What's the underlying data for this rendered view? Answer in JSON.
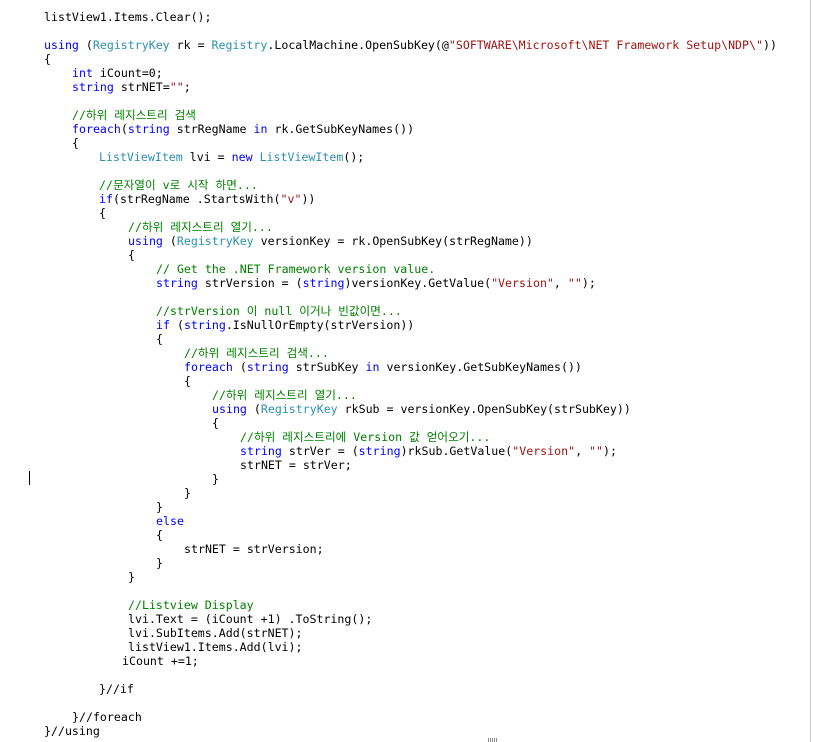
{
  "code": {
    "lines": [
      [
        {
          "t": "listView1.Items.Clear();"
        }
      ],
      [
        {
          "t": "using",
          "c": "kw"
        },
        {
          "t": " ("
        },
        {
          "t": "RegistryKey",
          "c": "typ"
        },
        {
          "t": " rk = "
        },
        {
          "t": "Registry",
          "c": "typ"
        },
        {
          "t": ".LocalMachine.OpenSubKey(@"
        },
        {
          "t": "\"SOFTWARE\\Microsoft\\NET Framework Setup\\NDP\\\"",
          "c": "str"
        },
        {
          "t": "))"
        }
      ],
      [
        {
          "t": "{"
        }
      ],
      [
        {
          "t": "int",
          "c": "kw"
        },
        {
          "t": " iCount=0;"
        }
      ],
      [
        {
          "t": "string",
          "c": "kw"
        },
        {
          "t": " strNET="
        },
        {
          "t": "\"\"",
          "c": "str"
        },
        {
          "t": ";"
        }
      ],
      [
        {
          "t": "//하위 레지스트리 검색",
          "c": "cm"
        }
      ],
      [
        {
          "t": "foreach",
          "c": "kw"
        },
        {
          "t": "("
        },
        {
          "t": "string",
          "c": "kw"
        },
        {
          "t": " strRegName "
        },
        {
          "t": "in",
          "c": "kw"
        },
        {
          "t": " rk.GetSubKeyNames())"
        }
      ],
      [
        {
          "t": "{"
        }
      ],
      [
        {
          "t": "ListViewItem",
          "c": "typ"
        },
        {
          "t": " lvi = "
        },
        {
          "t": "new",
          "c": "kw"
        },
        {
          "t": " "
        },
        {
          "t": "ListViewItem",
          "c": "typ"
        },
        {
          "t": "();"
        }
      ],
      [
        {
          "t": "//문자열이 v로 시작 하면...",
          "c": "cm"
        }
      ],
      [
        {
          "t": "if",
          "c": "kw"
        },
        {
          "t": "(strRegName .StartsWith("
        },
        {
          "t": "\"v\"",
          "c": "str"
        },
        {
          "t": "))"
        }
      ],
      [
        {
          "t": "{"
        }
      ],
      [
        {
          "t": "//하위 레지스트리 열기...",
          "c": "cm"
        }
      ],
      [
        {
          "t": "using",
          "c": "kw"
        },
        {
          "t": " ("
        },
        {
          "t": "RegistryKey",
          "c": "typ"
        },
        {
          "t": " versionKey = rk.OpenSubKey(strRegName))"
        }
      ],
      [
        {
          "t": "{"
        }
      ],
      [
        {
          "t": "// Get the .NET Framework version value.",
          "c": "cm"
        }
      ],
      [
        {
          "t": "string",
          "c": "kw"
        },
        {
          "t": " strVersion = ("
        },
        {
          "t": "string",
          "c": "kw"
        },
        {
          "t": ")versionKey.GetValue("
        },
        {
          "t": "\"Version\"",
          "c": "str"
        },
        {
          "t": ", "
        },
        {
          "t": "\"\"",
          "c": "str"
        },
        {
          "t": ");"
        }
      ],
      [
        {
          "t": "//strVersion 이 null 이거나 빈값이면...",
          "c": "cm"
        }
      ],
      [
        {
          "t": "if",
          "c": "kw"
        },
        {
          "t": " ("
        },
        {
          "t": "string",
          "c": "kw"
        },
        {
          "t": ".IsNullOrEmpty(strVersion))"
        }
      ],
      [
        {
          "t": "{"
        }
      ],
      [
        {
          "t": "//하위 레지스트리 검색...",
          "c": "cm"
        }
      ],
      [
        {
          "t": "foreach",
          "c": "kw"
        },
        {
          "t": " ("
        },
        {
          "t": "string",
          "c": "kw"
        },
        {
          "t": " strSubKey "
        },
        {
          "t": "in",
          "c": "kw"
        },
        {
          "t": " versionKey.GetSubKeyNames())"
        }
      ],
      [
        {
          "t": "{"
        }
      ],
      [
        {
          "t": "//하위 레지스트리 열기...",
          "c": "cm"
        }
      ],
      [
        {
          "t": "using",
          "c": "kw"
        },
        {
          "t": " ("
        },
        {
          "t": "RegistryKey",
          "c": "typ"
        },
        {
          "t": " rkSub = versionKey.OpenSubKey(strSubKey))"
        }
      ],
      [
        {
          "t": "{"
        }
      ],
      [
        {
          "t": "//하위 레지스트리에 Version 값 얻어오기...",
          "c": "cm"
        }
      ],
      [
        {
          "t": "string",
          "c": "kw"
        },
        {
          "t": " strVer = ("
        },
        {
          "t": "string",
          "c": "kw"
        },
        {
          "t": ")rkSub.GetValue("
        },
        {
          "t": "\"Version\"",
          "c": "str"
        },
        {
          "t": ", "
        },
        {
          "t": "\"\"",
          "c": "str"
        },
        {
          "t": ");"
        }
      ],
      [
        {
          "t": "strNET = strVer;"
        }
      ],
      [
        {
          "t": "}"
        }
      ],
      [
        {
          "t": "}"
        }
      ],
      [
        {
          "t": "}"
        }
      ],
      [
        {
          "t": "else",
          "c": "kw"
        }
      ],
      [
        {
          "t": "{"
        }
      ],
      [
        {
          "t": "strNET = strVersion;"
        }
      ],
      [
        {
          "t": "}"
        }
      ],
      [
        {
          "t": "}"
        }
      ],
      [
        {
          "t": "//Listview Display",
          "c": "cm"
        }
      ],
      [
        {
          "t": "lvi.Text = (iCount +1) .ToString();"
        }
      ],
      [
        {
          "t": "lvi.SubItems.Add(strNET);"
        }
      ],
      [
        {
          "t": "listView1.Items.Add(lvi);"
        }
      ],
      [
        {
          "t": "iCount +=1;"
        }
      ],
      [
        {
          "t": "}//if"
        }
      ],
      [
        {
          "t": "}//foreach"
        }
      ],
      [
        {
          "t": "}//using"
        }
      ]
    ]
  }
}
